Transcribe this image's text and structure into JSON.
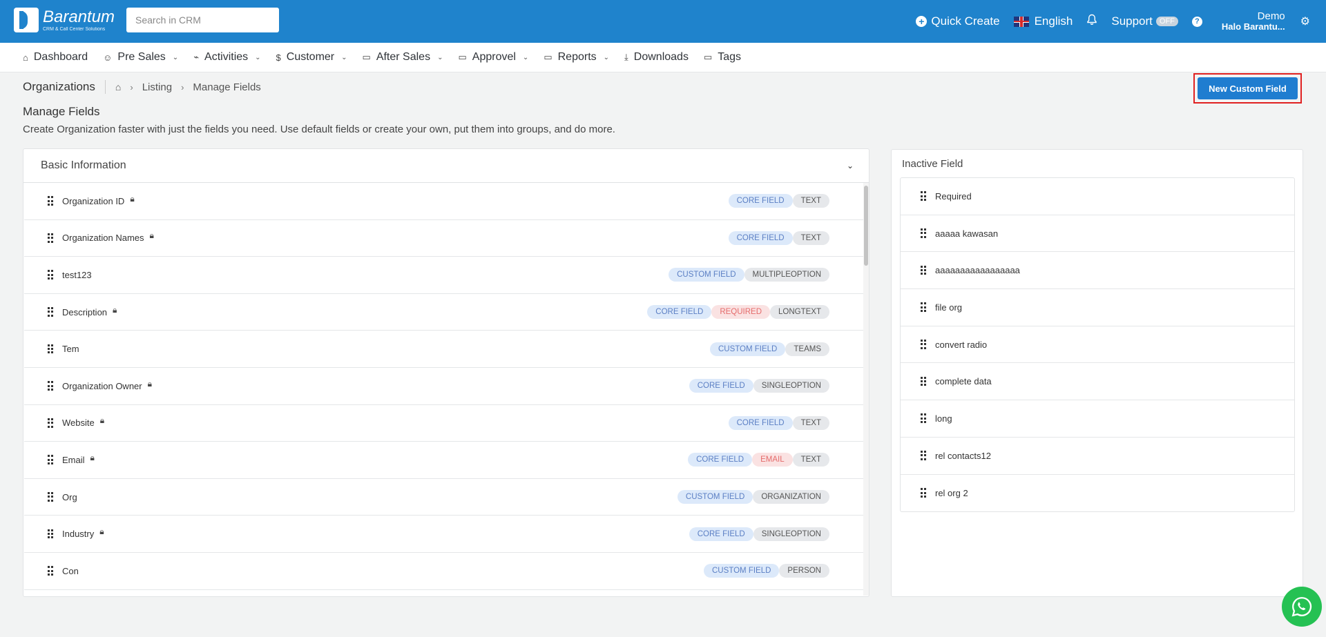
{
  "header": {
    "logo_name": "Barantum",
    "logo_tag": "CRM & Call Center Solutions",
    "search_placeholder": "Search in CRM",
    "quick_create": "Quick Create",
    "language": "English",
    "support": "Support",
    "support_badge": "OFF",
    "user_name": "Demo",
    "user_sub": "Halo Barantu..."
  },
  "nav": {
    "dashboard": "Dashboard",
    "pre_sales": "Pre Sales",
    "activities": "Activities",
    "customer": "Customer",
    "after_sales": "After Sales",
    "approvel": "Approvel",
    "reports": "Reports",
    "downloads": "Downloads",
    "tags": "Tags"
  },
  "breadcrumb": {
    "module": "Organizations",
    "listing": "Listing",
    "current": "Manage Fields"
  },
  "page": {
    "new_button": "New Custom Field",
    "heading": "Manage Fields",
    "description": "Create Organization faster with just the fields you need. Use default fields or create your own, put them into groups, and do more."
  },
  "basic": {
    "title": "Basic Information",
    "rows": [
      {
        "label": "Organization ID",
        "t1": "CORE FIELD",
        "t2": "",
        "t3": "TEXT"
      },
      {
        "label": "Organization Names",
        "t1": "CORE FIELD",
        "t2": "",
        "t3": "TEXT"
      },
      {
        "label": "test123",
        "t1": "CUSTOM FIELD",
        "t2": "",
        "t3": "MULTIPLEOPTION"
      },
      {
        "label": "Description",
        "t1": "CORE FIELD",
        "t2": "REQUIRED",
        "t3": "LONGTEXT"
      },
      {
        "label": "Tem",
        "t1": "CUSTOM FIELD",
        "t2": "",
        "t3": "TEAMS"
      },
      {
        "label": "Organization Owner",
        "t1": "CORE FIELD",
        "t2": "",
        "t3": "SINGLEOPTION"
      },
      {
        "label": "Website",
        "t1": "CORE FIELD",
        "t2": "",
        "t3": "TEXT"
      },
      {
        "label": "Email",
        "t1": "CORE FIELD",
        "t2": "EMAIL",
        "t3": "TEXT"
      },
      {
        "label": "Org",
        "t1": "CUSTOM FIELD",
        "t2": "",
        "t3": "ORGANIZATION"
      },
      {
        "label": "Industry",
        "t1": "CORE FIELD",
        "t2": "",
        "t3": "SINGLEOPTION"
      },
      {
        "label": "Con",
        "t1": "CUSTOM FIELD",
        "t2": "",
        "t3": "PERSON"
      }
    ]
  },
  "inactive": {
    "title": "Inactive Field",
    "items": [
      "Required",
      "aaaaa kawasan",
      "aaaaaaaaaaaaaaaaa",
      "file org",
      "convert radio",
      "complete data",
      "long",
      "rel contacts12",
      "rel org 2"
    ]
  }
}
